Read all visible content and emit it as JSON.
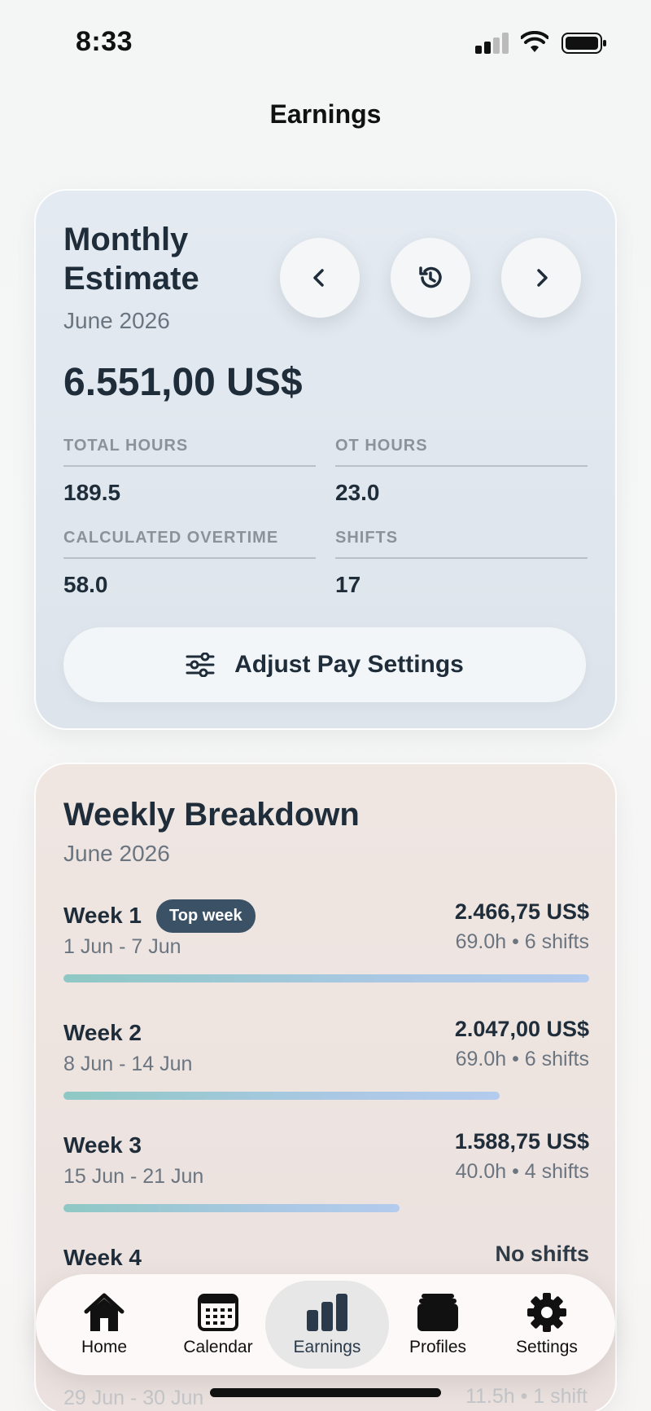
{
  "status_bar": {
    "time": "8:33"
  },
  "page": {
    "title": "Earnings"
  },
  "monthly": {
    "title_line1": "Monthly",
    "title_line2": "Estimate",
    "month": "June 2026",
    "amount": "6.551,00 US$",
    "stats": [
      {
        "label": "TOTAL HOURS",
        "value": "189.5"
      },
      {
        "label": "OT HOURS",
        "value": "23.0"
      },
      {
        "label": "CALCULATED OVERTIME",
        "value": "58.0"
      },
      {
        "label": "SHIFTS",
        "value": "17"
      }
    ],
    "adjust_label": "Adjust Pay Settings",
    "icons": {
      "prev": "chevron-left-icon",
      "history": "history-icon",
      "next": "chevron-right-icon",
      "adjust": "sliders-icon"
    }
  },
  "weekly": {
    "title": "Weekly Breakdown",
    "month": "June 2026",
    "top_badge": "Top week",
    "weeks": [
      {
        "name": "Week 1",
        "range": "1 Jun - 7 Jun",
        "amount": "2.466,75 US$",
        "meta": "69.0h • 6 shifts",
        "progress": 1.0
      },
      {
        "name": "Week 2",
        "range": "8 Jun - 14 Jun",
        "amount": "2.047,00 US$",
        "meta": "69.0h • 6 shifts",
        "progress": 0.83
      },
      {
        "name": "Week 3",
        "range": "15 Jun - 21 Jun",
        "amount": "1.588,75 US$",
        "meta": "40.0h • 4 shifts",
        "progress": 0.64
      },
      {
        "name": "Week 4",
        "range": "",
        "amount": "No shifts",
        "meta": "",
        "progress": 0
      },
      {
        "name": "",
        "range": "29 Jun - 30 Jun",
        "amount": "",
        "meta": "11.5h • 1 shift",
        "progress": 0
      }
    ]
  },
  "tabs": [
    {
      "label": "Home",
      "icon": "house-icon"
    },
    {
      "label": "Calendar",
      "icon": "calendar-icon"
    },
    {
      "label": "Earnings",
      "icon": "bar-chart-icon",
      "active": true
    },
    {
      "label": "Profiles",
      "icon": "stack-icon"
    },
    {
      "label": "Settings",
      "icon": "gear-icon"
    }
  ],
  "colors": {
    "accent": "#3b5266",
    "monthly_bg": "#e2e8ef",
    "weekly_bg": "#ede3df"
  }
}
